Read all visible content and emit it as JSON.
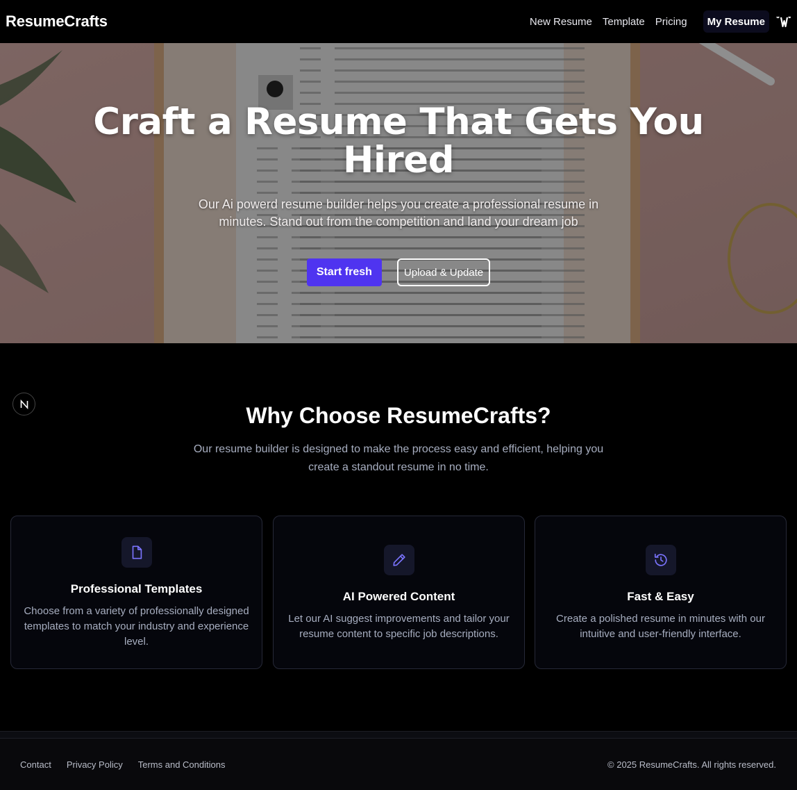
{
  "header": {
    "brand": "ResumeCrafts",
    "nav": [
      "New Resume",
      "Template",
      "Pricing"
    ],
    "my_resume_label": "My Resume"
  },
  "hero": {
    "title": "Craft a Resume That Gets You Hired",
    "subtitle": "Our Ai powerd resume builder helps you create a professional resume in minutes. Stand out from the competition and land your dream job",
    "primary_button": "Start fresh",
    "secondary_button": "Upload & Update"
  },
  "why": {
    "badge": "N",
    "title": "Why Choose ResumeCrafts?",
    "subtitle": "Our resume builder is designed to make the process easy and efficient, helping you create a standout resume in no time.",
    "cards": [
      {
        "icon": "file-icon",
        "title": "Professional Templates",
        "description": "Choose from a variety of professionally designed templates to match your industry and experience level."
      },
      {
        "icon": "pencil-icon",
        "title": "AI Powered Content",
        "description": "Let our AI suggest improvements and tailor your resume content to specific job descriptions."
      },
      {
        "icon": "history-icon",
        "title": "Fast & Easy",
        "description": "Create a polished resume in minutes with our intuitive and user-friendly interface."
      }
    ]
  },
  "footer": {
    "links": [
      "Contact",
      "Privacy Policy",
      "Terms and Conditions"
    ],
    "copyright": "© 2025 ResumeCrafts. All rights reserved."
  },
  "colors": {
    "accent": "#4f34f0",
    "icon_accent": "#7b74ff",
    "background": "#000000",
    "muted_text": "#a7aec0"
  }
}
